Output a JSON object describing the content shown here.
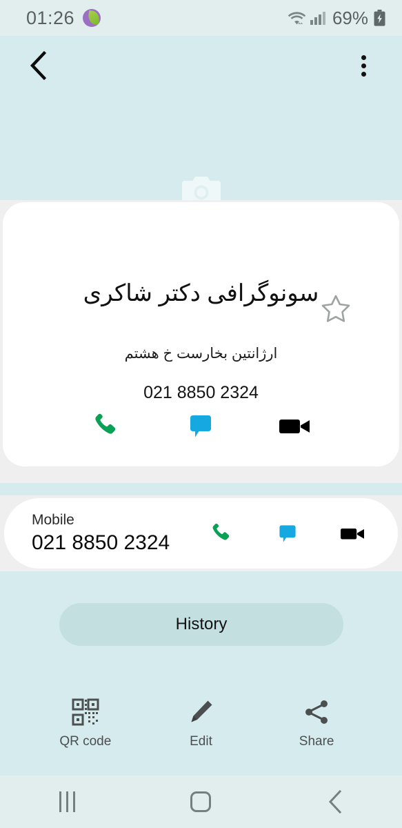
{
  "status_bar": {
    "time": "01:26",
    "app_icon": "leaf-icon",
    "wifi_icon": "wifi-icon",
    "signal_icon": "cellular-signal-icon",
    "battery_percent": "69%",
    "battery_icon": "battery-charging-icon"
  },
  "app_bar": {
    "back_icon": "back-chevron-icon",
    "more_icon": "overflow-menu-icon"
  },
  "hero": {
    "photo_placeholder_icon": "camera-icon"
  },
  "contact": {
    "name": "سونوگرافی دکتر شاکری",
    "subtitle": "ارژانتین بخارست خ هشتم",
    "number": "021 8850 2324",
    "favorite_icon": "star-outline-icon",
    "actions": [
      {
        "name": "call",
        "icon": "phone-icon",
        "color": "#09a254"
      },
      {
        "name": "message",
        "icon": "message-bubble-icon",
        "color": "#16a9e1"
      },
      {
        "name": "video-call",
        "icon": "video-camera-icon",
        "color": "#000000"
      }
    ]
  },
  "mobile_row": {
    "label": "Mobile",
    "number": "021 8850 2324",
    "actions": [
      {
        "name": "call",
        "icon": "phone-icon",
        "color": "#09a254"
      },
      {
        "name": "message",
        "icon": "message-bubble-icon",
        "color": "#16a9e1"
      },
      {
        "name": "video-call",
        "icon": "video-camera-icon",
        "color": "#000000"
      }
    ]
  },
  "history": {
    "label": "History"
  },
  "bottom_actions": [
    {
      "label": "QR code",
      "icon": "qr-code-icon"
    },
    {
      "label": "Edit",
      "icon": "pencil-icon"
    },
    {
      "label": "Share",
      "icon": "share-icon"
    }
  ],
  "nav_bar": {
    "recents_icon": "recents-icon",
    "home_icon": "home-icon",
    "back_icon": "back-chevron-icon"
  },
  "colors": {
    "background": "#d5ebed",
    "status_bar": "#e2eeee",
    "card": "#ffffff",
    "card_gap": "#efefef",
    "history_button": "#c4dfe0",
    "accent_call": "#09a254",
    "accent_message": "#16a9e1",
    "accent_video": "#000000"
  }
}
